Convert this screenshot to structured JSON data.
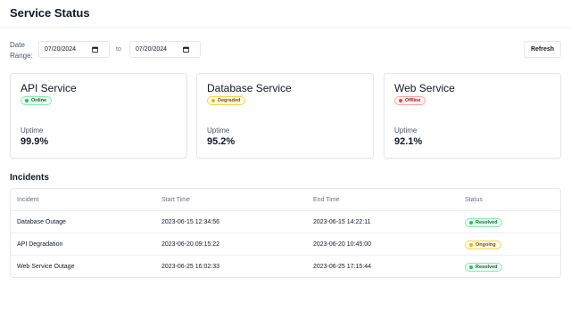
{
  "header": {
    "title": "Service Status"
  },
  "filters": {
    "date_range_label": "Date Range:",
    "from_date": "07/20/2024",
    "to_label": "to",
    "to_date": "07/20/2024",
    "refresh_label": "Refresh"
  },
  "services": [
    {
      "name": "API Service",
      "status": "Online",
      "uptime_label": "Uptime",
      "uptime": "99.9%",
      "status_color": "#22c55e"
    },
    {
      "name": "Database Service",
      "status": "Degraded",
      "uptime_label": "Uptime",
      "uptime": "95.2%",
      "status_color": "#eab308"
    },
    {
      "name": "Web Service",
      "status": "Offline",
      "uptime_label": "Uptime",
      "uptime": "92.1%",
      "status_color": "#ef4444"
    }
  ],
  "incidents": {
    "title": "Incidents",
    "columns": [
      "Incident",
      "Start Time",
      "End Time",
      "Status"
    ],
    "rows": [
      {
        "incident": "Database Outage",
        "start": "2023-06-15 12:34:56",
        "end": "2023-06-15 14:22:11",
        "status": "Resolved"
      },
      {
        "incident": "API Degradation",
        "start": "2023-06-20 09:15:22",
        "end": "2023-06-20 10:45:00",
        "status": "Ongoing"
      },
      {
        "incident": "Web Service Outage",
        "start": "2023-06-25 16:02:33",
        "end": "2023-06-25 17:15:44",
        "status": "Resolved"
      }
    ]
  }
}
